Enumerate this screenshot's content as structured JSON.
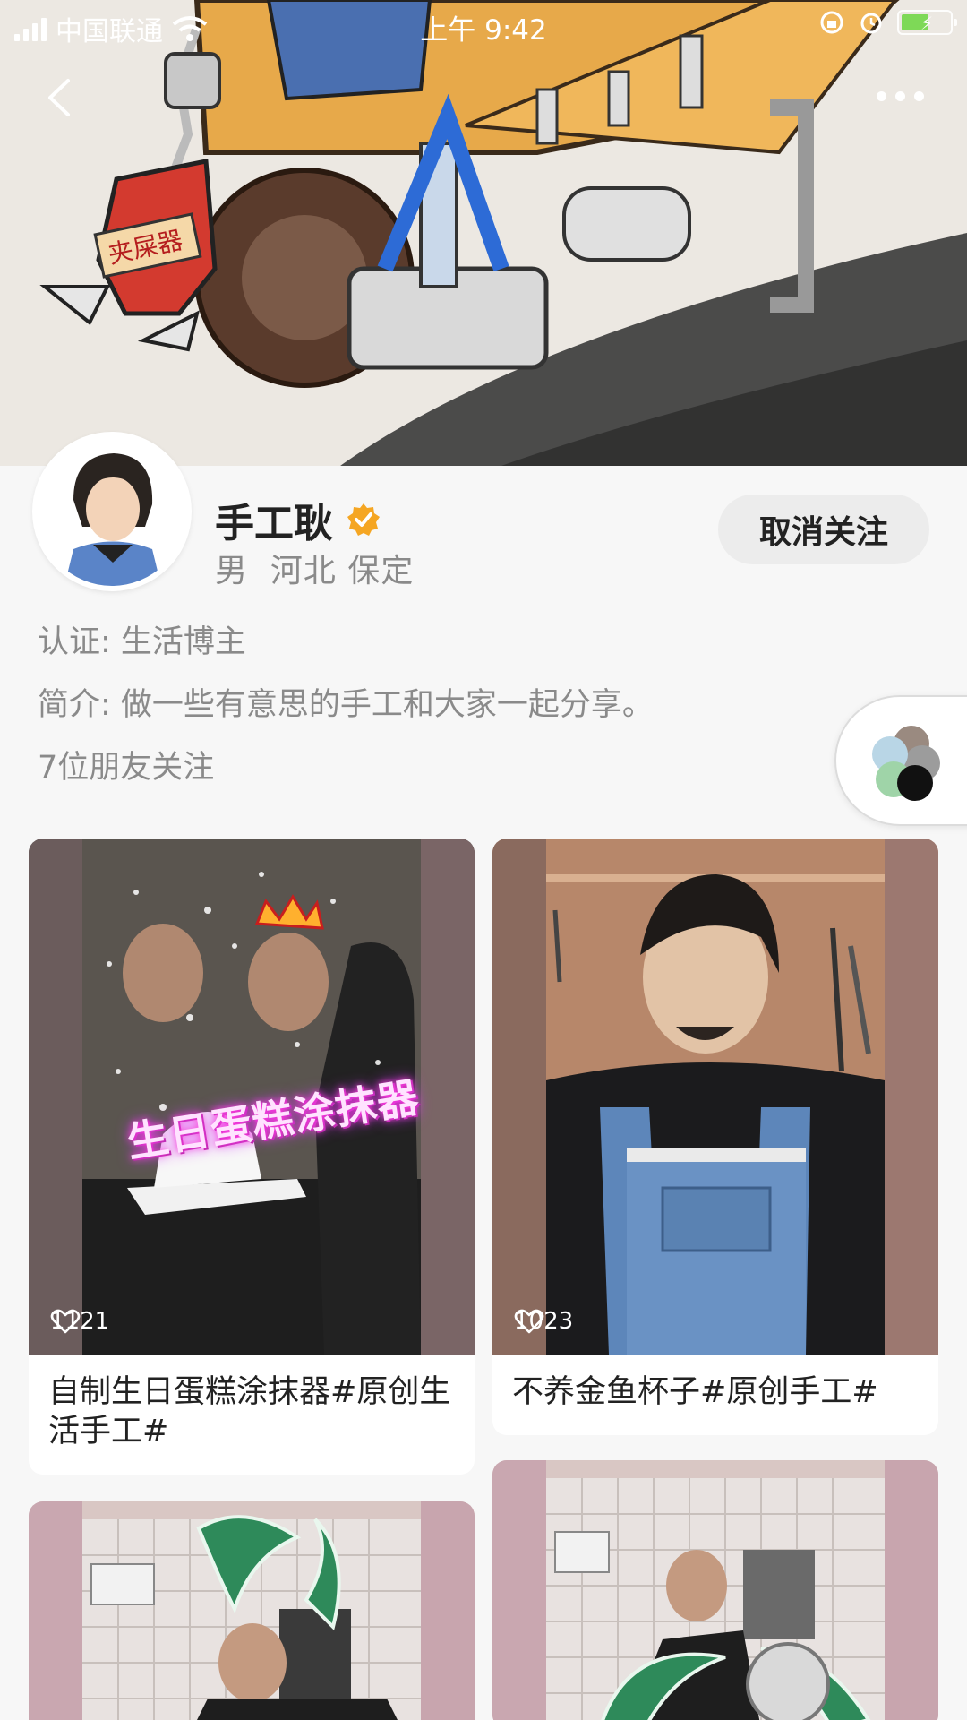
{
  "status_bar": {
    "carrier": "中国联通",
    "time": "上午 9:42"
  },
  "cover": {
    "sign_text": "夹屎器"
  },
  "profile": {
    "name": "手工耿",
    "gender": "男",
    "location": "河北 保定",
    "follow_button": "取消关注",
    "certification": "认证: 生活博主",
    "bio": "简介: 做一些有意思的手工和大家一起分享。",
    "friends_following": "7位朋友关注"
  },
  "videos": [
    {
      "likes": "1121",
      "title": "自制生日蛋糕涂抹器#原创生活手工#",
      "overlay_text": "生日蛋糕涂抹器"
    },
    {
      "likes": "1023",
      "title": "不养金鱼杯子#原创手工#"
    },
    {
      "likes": "",
      "title": ""
    },
    {
      "likes": "",
      "title": ""
    }
  ],
  "colors": {
    "verified_badge": "#f5a623",
    "page_background": "#f7f7f7",
    "card_background": "#ffffff"
  }
}
